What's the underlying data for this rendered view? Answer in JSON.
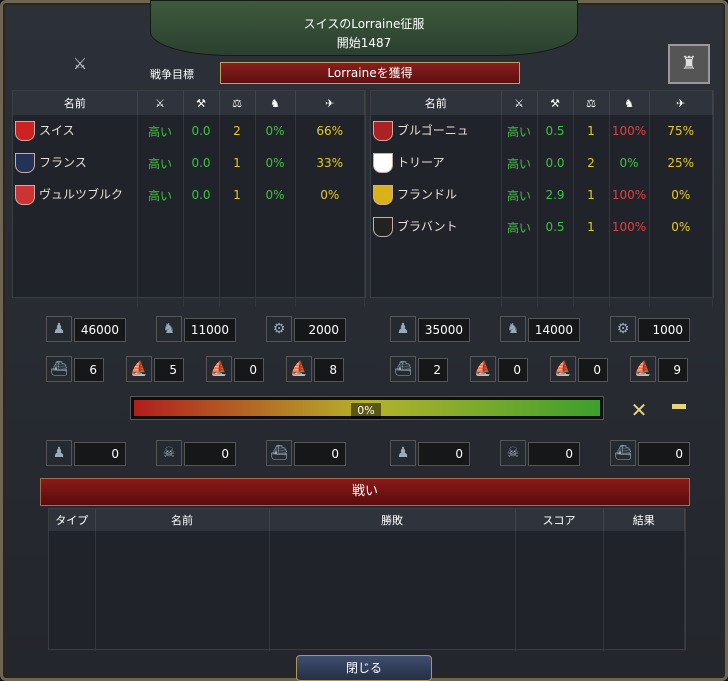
{
  "war_title": "スイスのLorraine征服",
  "war_start": "開始1487",
  "goal": {
    "label": "戦争目標",
    "value": "Lorraineを獲得"
  },
  "columns": {
    "name": "名前",
    "icons": [
      "swords-icon",
      "morale-icon",
      "balance-icon",
      "tax-icon",
      "flee-icon"
    ]
  },
  "attackers": [
    {
      "name": "スイス",
      "v": [
        "高い",
        "0.0",
        "2",
        "0%",
        "66%"
      ],
      "colors": [
        "g",
        "g",
        "y",
        "g",
        "y"
      ],
      "flag": "#c22"
    },
    {
      "name": "フランス",
      "v": [
        "高い",
        "0.0",
        "1",
        "0%",
        "33%"
      ],
      "colors": [
        "g",
        "g",
        "y",
        "g",
        "y"
      ],
      "flag": "#235"
    },
    {
      "name": "ヴュルツブルク",
      "v": [
        "高い",
        "0.0",
        "1",
        "0%",
        "0%"
      ],
      "colors": [
        "g",
        "g",
        "y",
        "g",
        "y"
      ],
      "flag": "#c33"
    }
  ],
  "defenders": [
    {
      "name": "ブルゴーニュ",
      "v": [
        "高い",
        "0.5",
        "1",
        "100%",
        "75%"
      ],
      "colors": [
        "g",
        "g",
        "y",
        "r",
        "y"
      ],
      "flag": "#a22"
    },
    {
      "name": "トリーア",
      "v": [
        "高い",
        "0.0",
        "2",
        "0%",
        "25%"
      ],
      "colors": [
        "g",
        "g",
        "y",
        "g",
        "y"
      ],
      "flag": "#fff"
    },
    {
      "name": "フランドル",
      "v": [
        "高い",
        "2.9",
        "1",
        "100%",
        "0%"
      ],
      "colors": [
        "g",
        "g",
        "y",
        "r",
        "y"
      ],
      "flag": "#d9b21a"
    },
    {
      "name": "ブラバント",
      "v": [
        "高い",
        "0.5",
        "1",
        "100%",
        "0%"
      ],
      "colors": [
        "g",
        "g",
        "y",
        "r",
        "y"
      ],
      "flag": "#222"
    }
  ],
  "forces": {
    "left": {
      "infantry": "46000",
      "cavalry": "11000",
      "artillery": "2000",
      "heavy": "6",
      "light": "5",
      "galley": "0",
      "transport": "8"
    },
    "right": {
      "infantry": "35000",
      "cavalry": "14000",
      "artillery": "1000",
      "heavy": "2",
      "light": "0",
      "galley": "0",
      "transport": "9"
    }
  },
  "warscore": {
    "percent": 0,
    "label": "0%"
  },
  "losses": {
    "left": [
      "0",
      "0",
      "0"
    ],
    "right": [
      "0",
      "0",
      "0"
    ]
  },
  "battles": {
    "title": "戦い",
    "cols": [
      "タイプ",
      "名前",
      "勝敗",
      "スコア",
      "結果"
    ]
  },
  "close": "閉じる"
}
